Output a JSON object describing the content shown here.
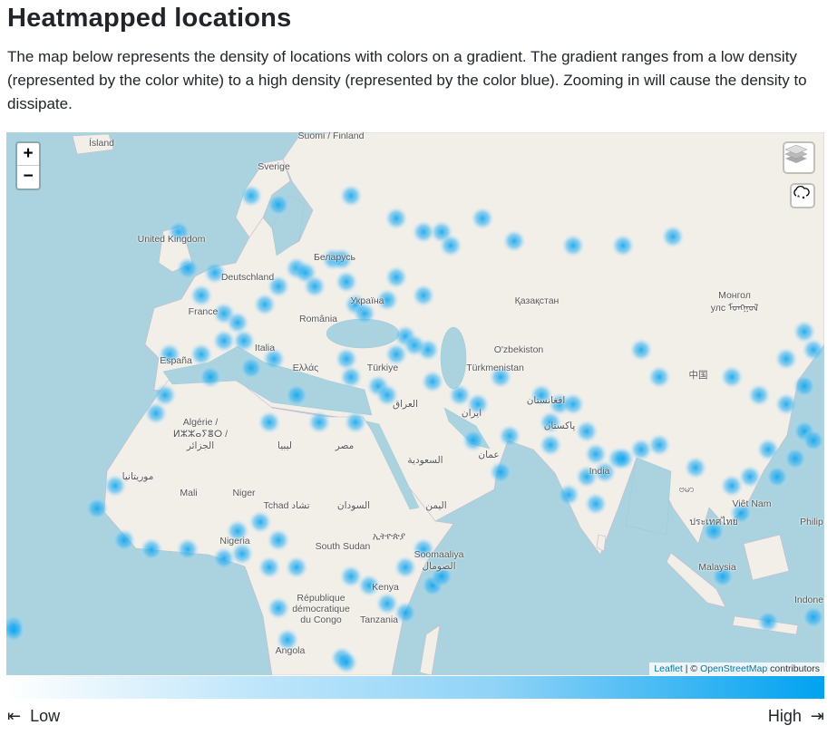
{
  "header": {
    "title": "Heatmapped locations",
    "description": "The map below represents the density of locations with colors on a gradient. The gradient ranges from a low density (represented by the color white) to a high density (represented by the color blue). Zooming in will cause the density to dissipate."
  },
  "map": {
    "zoom_in": "+",
    "zoom_out": "−",
    "layers_icon": "layers-icon",
    "weather_icon": "cloud-snow-icon",
    "attribution": {
      "leaflet": "Leaflet",
      "sep": " | © ",
      "osm": "OpenStreetMap",
      "suffix": " contributors"
    },
    "labels": [
      "Ísland",
      "Suomi / Finland",
      "Sverige",
      "United Kingdom",
      "Беларусь",
      "Deutschland",
      "Україна",
      "Қазақстан",
      "Монгол",
      "улс ᠮᠣᠩᠭᠣᠯ",
      "France",
      "România",
      "España",
      "Italia",
      "Ελλάς",
      "Türkiye",
      "O'zbekiston",
      "Türkmenistan",
      "中国",
      "Algérie /",
      "ⵍⵣⵣⴰⵢⴻⵔ /",
      "الجزائر",
      "ليبيا",
      "مصر",
      "العراق",
      "ایران",
      "افغانستان",
      "پاکستان",
      "السعودية",
      "عمان",
      "India",
      "ဗမာ",
      "Việt Nam",
      "Philip",
      "ประเทศไทย",
      "موريتانيا",
      "Mali",
      "Niger",
      "Tchad تشاد",
      "السودان",
      "اليمن",
      "ኢትዮጵያ",
      "Soomaaliya",
      "الصومال",
      "Nigeria",
      "South Sudan",
      "Kenya",
      "République",
      "démocratique",
      "du Congo",
      "Tanzania",
      "Angola",
      "Malaysia",
      "Indone"
    ],
    "heat_colors": {
      "low": "#ffffff",
      "high": "#00a2f0"
    }
  },
  "legend": {
    "low": "Low",
    "high": "High",
    "low_icon": "arrow-left-to-bar-icon",
    "high_icon": "arrow-right-to-bar-icon"
  }
}
